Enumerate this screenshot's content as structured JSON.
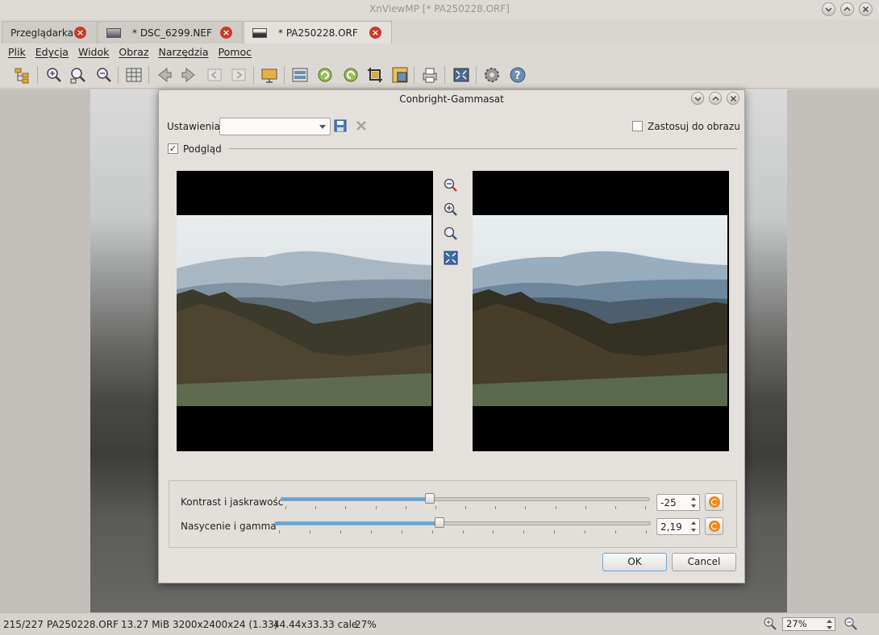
{
  "window": {
    "title": "XnViewMP [* PA250228.ORF]"
  },
  "tabs": [
    {
      "label": "Przeglądarka",
      "active": false
    },
    {
      "label": "* DSC_6299.NEF",
      "active": false
    },
    {
      "label": "* PA250228.ORF",
      "active": true
    }
  ],
  "menu": [
    "Plik",
    "Edycja",
    "Widok",
    "Obraz",
    "Narzędzia",
    "Pomoc"
  ],
  "dialog": {
    "title": "Conbright-Gammasat",
    "presets_label": "Ustawienia:",
    "presets_value": "",
    "apply_to_image_label": "Zastosuj do obrazu",
    "apply_to_image_checked": false,
    "preview_label": "Podgląd",
    "preview_checked": true,
    "sliders": [
      {
        "label": "Kontrast i jaskrawość",
        "value": "-25",
        "fraction": 0.405
      },
      {
        "label": "Nasycenie i gamma",
        "value": "2,19",
        "fraction": 0.439
      }
    ],
    "ok_label": "OK",
    "cancel_label": "Cancel"
  },
  "status": {
    "index": "215/227",
    "filename": "PA250228.ORF",
    "filesize": "13.27 MiB",
    "dimensions": "3200x2400x24 (1.33)",
    "print_size": "44.44x33.33 cale",
    "zoom_percent": "27%",
    "zoom_select": "27%"
  },
  "colors": {
    "accent": "#5aa8e0",
    "close_tab": "#c9392a",
    "reset": "#f08a18"
  }
}
